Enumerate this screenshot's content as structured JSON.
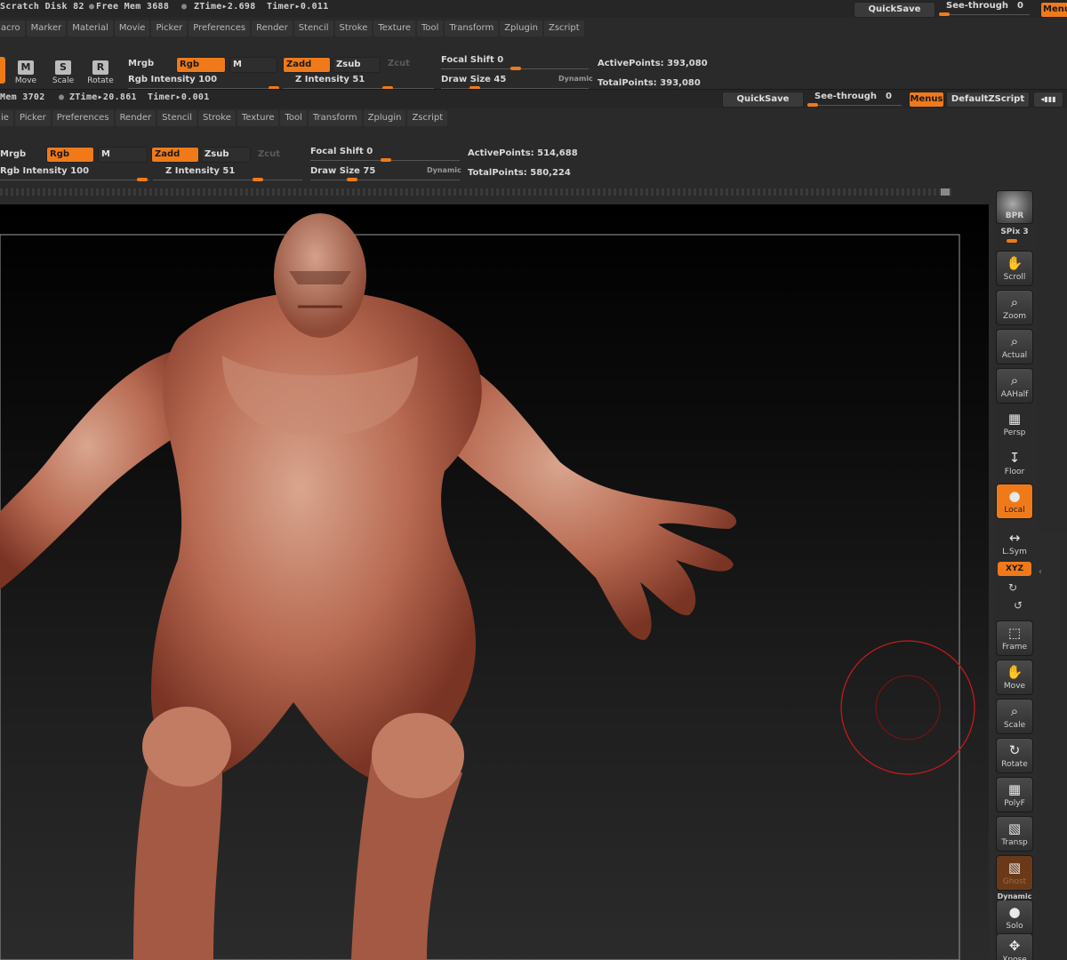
{
  "top_status": {
    "scratch": "Scratch Disk 82",
    "free_mem": "Free Mem 3688",
    "ztime": "ZTime▸2.698",
    "timer": "Timer▸0.011"
  },
  "top_right": {
    "quicksave": "QuickSave",
    "see_through": "See-through",
    "see_through_value": "0",
    "menus": "Menu"
  },
  "menu_top": [
    "acro",
    "Marker",
    "Material",
    "Movie",
    "Picker",
    "Preferences",
    "Render",
    "Stencil",
    "Stroke",
    "Texture",
    "Tool",
    "Transform",
    "Zplugin",
    "Zscript"
  ],
  "tool_top": {
    "modes": [
      {
        "glyph": "M",
        "label": "Move"
      },
      {
        "glyph": "S",
        "label": "Scale"
      },
      {
        "glyph": "R",
        "label": "Rotate"
      }
    ],
    "mrgb": "Mrgb",
    "rgb": "Rgb",
    "m": "M",
    "zadd": "Zadd",
    "zsub": "Zsub",
    "zcut": "Zcut",
    "rgb_intensity": "Rgb Intensity 100",
    "z_intensity": "Z Intensity 51",
    "focal_shift": "Focal Shift 0",
    "draw_size": "Draw Size 45",
    "dynamic": "Dynamic",
    "active_points": "ActivePoints: 393,080",
    "total_points": "TotalPoints: 393,080"
  },
  "second_status": {
    "mem": "Mem 3702",
    "ztime": "ZTime▸20.861",
    "timer": "Timer▸0.001"
  },
  "second_right": {
    "quicksave": "QuickSave",
    "see_through": "See-through",
    "see_through_value": "0",
    "menus": "Menus",
    "zscript": "DefaultZScript"
  },
  "menu_second": [
    "ie",
    "Picker",
    "Preferences",
    "Render",
    "Stencil",
    "Stroke",
    "Texture",
    "Tool",
    "Transform",
    "Zplugin",
    "Zscript"
  ],
  "tool_second": {
    "mrgb": "Mrgb",
    "rgb": "Rgb",
    "m": "M",
    "zadd": "Zadd",
    "zsub": "Zsub",
    "zcut": "Zcut",
    "rgb_intensity": "Rgb Intensity 100",
    "z_intensity": "Z Intensity 51",
    "focal_shift": "Focal Shift 0",
    "draw_size": "Draw Size 75",
    "dynamic": "Dynamic",
    "active_points": "ActivePoints: 514,688",
    "total_points": "TotalPoints: 580,224"
  },
  "shelf": {
    "bpr": "BPR",
    "spix": "SPix 3",
    "buttons": [
      {
        "name": "scroll",
        "icon": "hand-icon",
        "glyph": "✋",
        "label": "Scroll"
      },
      {
        "name": "zoom",
        "icon": "magnifier-icon",
        "glyph": "⌕",
        "label": "Zoom"
      },
      {
        "name": "actual",
        "icon": "magnifier-icon",
        "glyph": "⌕",
        "label": "Actual"
      },
      {
        "name": "aahalf",
        "icon": "magnifier-icon",
        "glyph": "⌕",
        "label": "AAHalf"
      },
      {
        "name": "persp",
        "icon": "grid-icon",
        "glyph": "▦",
        "label": "Persp"
      },
      {
        "name": "floor",
        "icon": "floor-icon",
        "glyph": "↧",
        "label": "Floor"
      },
      {
        "name": "local",
        "icon": "local-icon",
        "glyph": "●",
        "label": "Local"
      },
      {
        "name": "lsym",
        "icon": "symmetry-icon",
        "glyph": "↔",
        "label": "L.Sym"
      },
      {
        "name": "frame",
        "icon": "frame-icon",
        "glyph": "⬚",
        "label": "Frame"
      },
      {
        "name": "move",
        "icon": "hand-icon",
        "glyph": "✋",
        "label": "Move"
      },
      {
        "name": "scale",
        "icon": "magnifier-icon",
        "glyph": "⌕",
        "label": "Scale"
      },
      {
        "name": "rotate",
        "icon": "rotate-icon",
        "glyph": "↻",
        "label": "Rotate"
      },
      {
        "name": "polyf",
        "icon": "grid-icon",
        "glyph": "▦",
        "label": "PolyF"
      },
      {
        "name": "transp",
        "icon": "transp-icon",
        "glyph": "▧",
        "label": "Transp"
      },
      {
        "name": "ghost",
        "icon": "ghost-icon",
        "glyph": "▧",
        "label": "Ghost"
      },
      {
        "name": "solo",
        "icon": "solo-icon",
        "glyph": "●",
        "label": "Solo"
      },
      {
        "name": "xpose",
        "icon": "xpose-icon",
        "glyph": "✥",
        "label": "Xpose"
      }
    ],
    "xyz": "XYZ",
    "dynamic": "Dynamic"
  },
  "colors": {
    "accent": "#f07a1a",
    "skin": "#c0745c",
    "brush_ring": "#cc1a1a"
  }
}
